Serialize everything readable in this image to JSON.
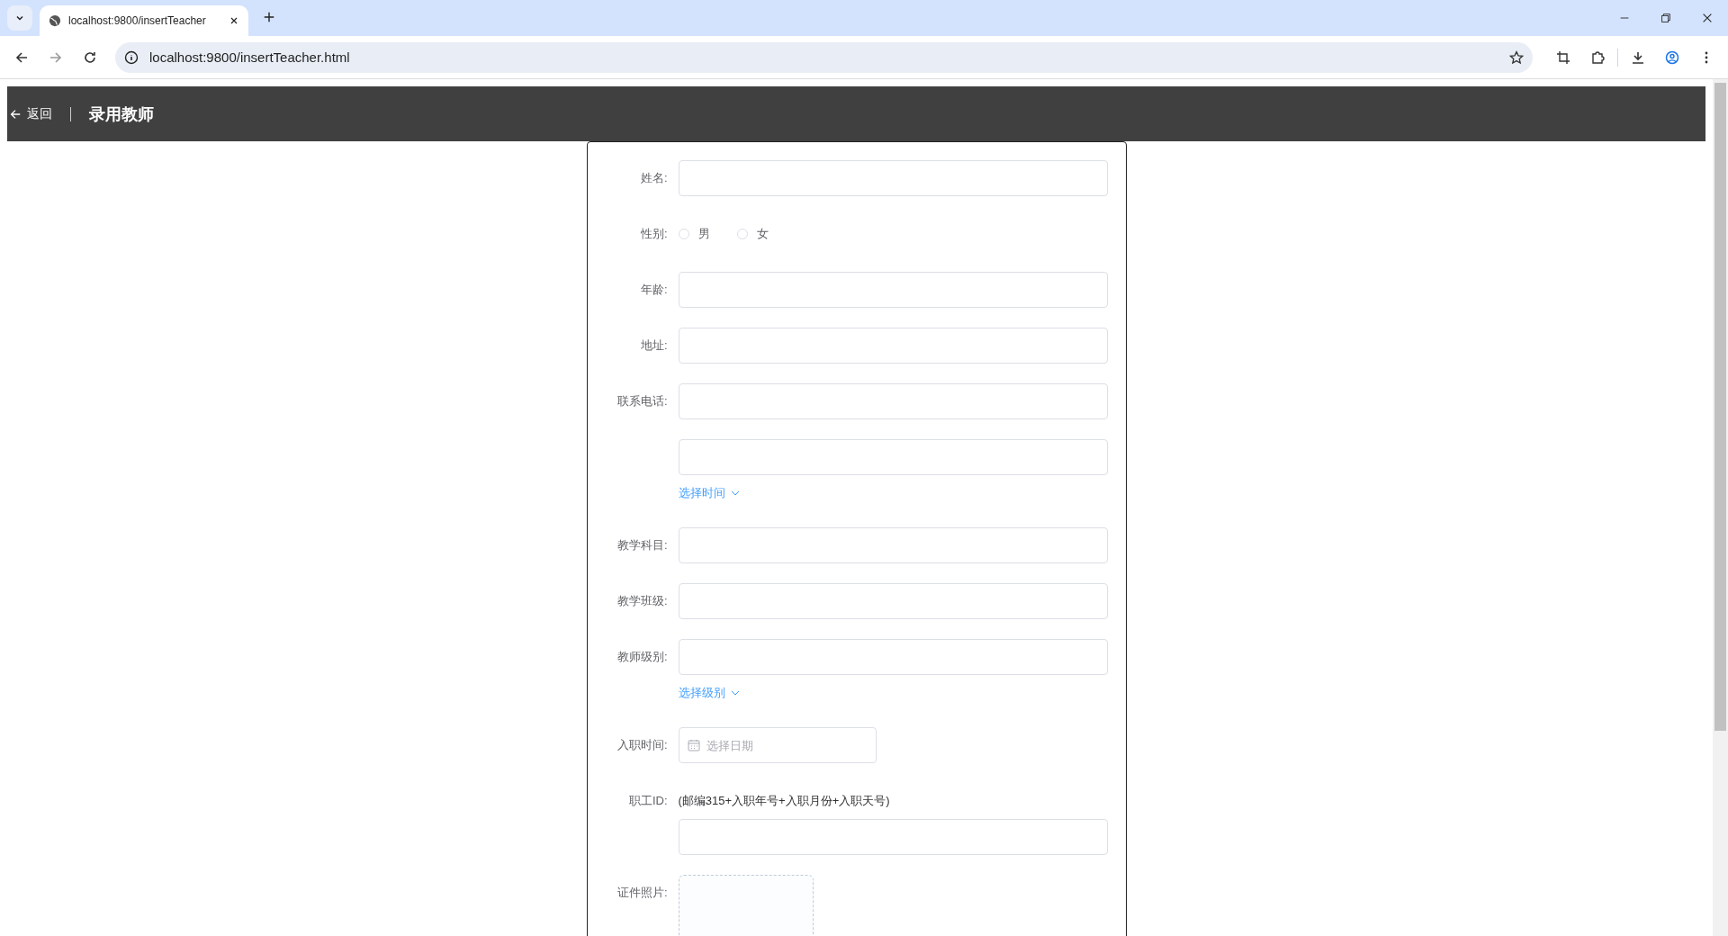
{
  "browser": {
    "tab_title": "localhost:9800/insertTeacher",
    "url": "localhost:9800/insertTeacher.html"
  },
  "header": {
    "back": "返回",
    "title": "录用教师"
  },
  "form": {
    "fields": [
      {
        "kind": "text",
        "label": "姓名:"
      },
      {
        "kind": "radio",
        "label": "性别:",
        "options": [
          {
            "label": "男",
            "selected": false
          },
          {
            "label": "女",
            "selected": false
          }
        ]
      },
      {
        "kind": "text",
        "label": "年龄:"
      },
      {
        "kind": "text",
        "label": "地址:"
      },
      {
        "kind": "text",
        "label": "联系电话:"
      },
      {
        "kind": "text",
        "link": "选择时间"
      },
      {
        "kind": "text",
        "label": "教学科目:"
      },
      {
        "kind": "text",
        "label": "教学班级:"
      },
      {
        "kind": "text",
        "label": "教师级别:",
        "link": "选择级别"
      },
      {
        "kind": "date",
        "label": "入职时间:",
        "placeholder": "选择日期"
      },
      {
        "kind": "text",
        "label": "职工ID:",
        "hint": "(邮编315+入职年号+入职月份+入职天号)"
      },
      {
        "kind": "upload",
        "label": "证件照片:"
      }
    ]
  }
}
